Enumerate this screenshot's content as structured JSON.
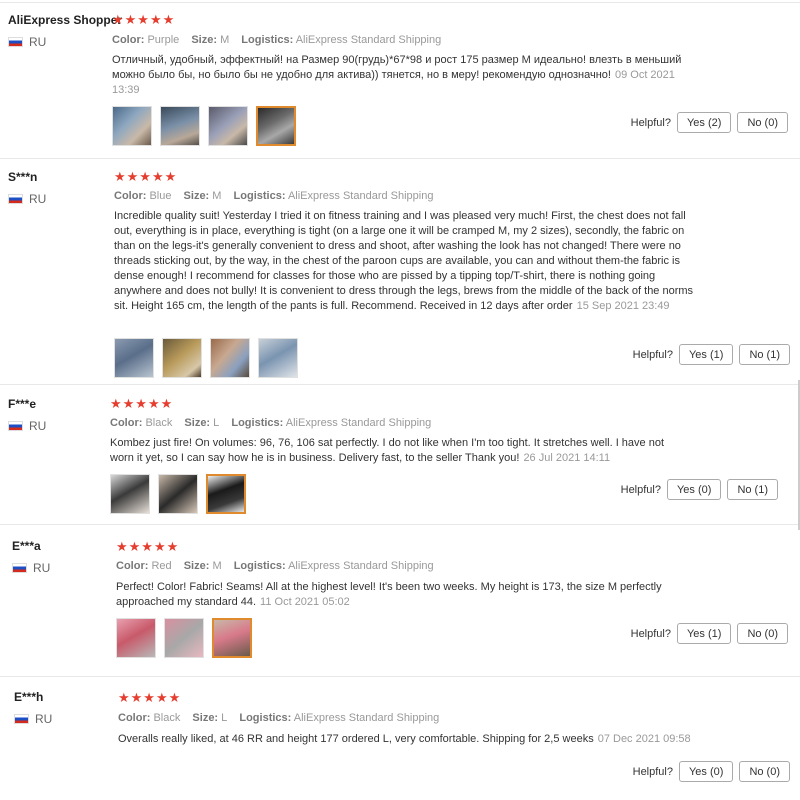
{
  "labels": {
    "color": "Color:",
    "size": "Size:",
    "logistics": "Logistics:",
    "helpful": "Helpful?"
  },
  "colors": {
    "star": "#e53e2f",
    "selected_thumb_border": "#e08a2e"
  },
  "reviews": [
    {
      "name": "AliExpress Shopper",
      "country": "RU",
      "stars": "★★★★★",
      "color": "Purple",
      "size": "M",
      "logistics": "AliExpress Standard Shipping",
      "text": "Отличный, удобный, эффектный! на Размер 90(грудь)*67*98 и рост 175 размер М идеально! влезть в меньший можно было бы, но было бы не удобно для актива)) тянется, но в меру! рекомендую однозначно!",
      "date": "09 Oct 2021 13:39",
      "yes": "Yes (2)",
      "no": "No (0)"
    },
    {
      "name": "S***n",
      "country": "RU",
      "stars": "★★★★★",
      "color": "Blue",
      "size": "M",
      "logistics": "AliExpress Standard Shipping",
      "text": "Incredible quality suit! Yesterday I tried it on fitness training and I was pleased very much! First, the chest does not fall out, everything is in place, everything is tight (on a large one it will be cramped M, my 2 sizes), secondly, the fabric on than on the legs-it's generally convenient to dress and shoot, after washing the look has not changed! There were no threads sticking out, by the way, in the chest of the paroon cups are available, you can and without them-the fabric is dense enough! I recommend for classes for those who are pissed by a tipping top/T-shirt, there is nothing going anywhere and does not bully! It is convenient to dress through the legs, brews from the middle of the back of the norms sit. Height 165 cm, the length of the pants is full. Recommend. Received in 12 days after order",
      "date": "15 Sep 2021 23:49",
      "yes": "Yes (1)",
      "no": "No (1)"
    },
    {
      "name": "F***e",
      "country": "RU",
      "stars": "★★★★★",
      "color": "Black",
      "size": "L",
      "logistics": "AliExpress Standard Shipping",
      "text": "Kombez just fire! On volumes: 96, 76, 106 sat perfectly. I do not like when I'm too tight. It stretches well. I have not worn it yet, so I can say how he is in business. Delivery fast, to the seller Thank you!",
      "date": "26 Jul 2021 14:11",
      "yes": "Yes (0)",
      "no": "No (1)"
    },
    {
      "name": "E***a",
      "country": "RU",
      "stars": "★★★★★",
      "color": "Red",
      "size": "M",
      "logistics": "AliExpress Standard Shipping",
      "text": "Perfect! Color! Fabric! Seams! All at the highest level! It's been two weeks. My height is 173, the size M perfectly approached my standard 44.",
      "date": "11 Oct 2021 05:02",
      "yes": "Yes (1)",
      "no": "No (0)"
    },
    {
      "name": "E***h",
      "country": "RU",
      "stars": "★★★★★",
      "color": "Black",
      "size": "L",
      "logistics": "AliExpress Standard Shipping",
      "text": "Overalls really liked, at 46 RR and height 177 ordered L, very comfortable. Shipping for 2,5 weeks",
      "date": "07 Dec 2021 09:58",
      "yes": "Yes (0)",
      "no": "No (0)"
    }
  ]
}
